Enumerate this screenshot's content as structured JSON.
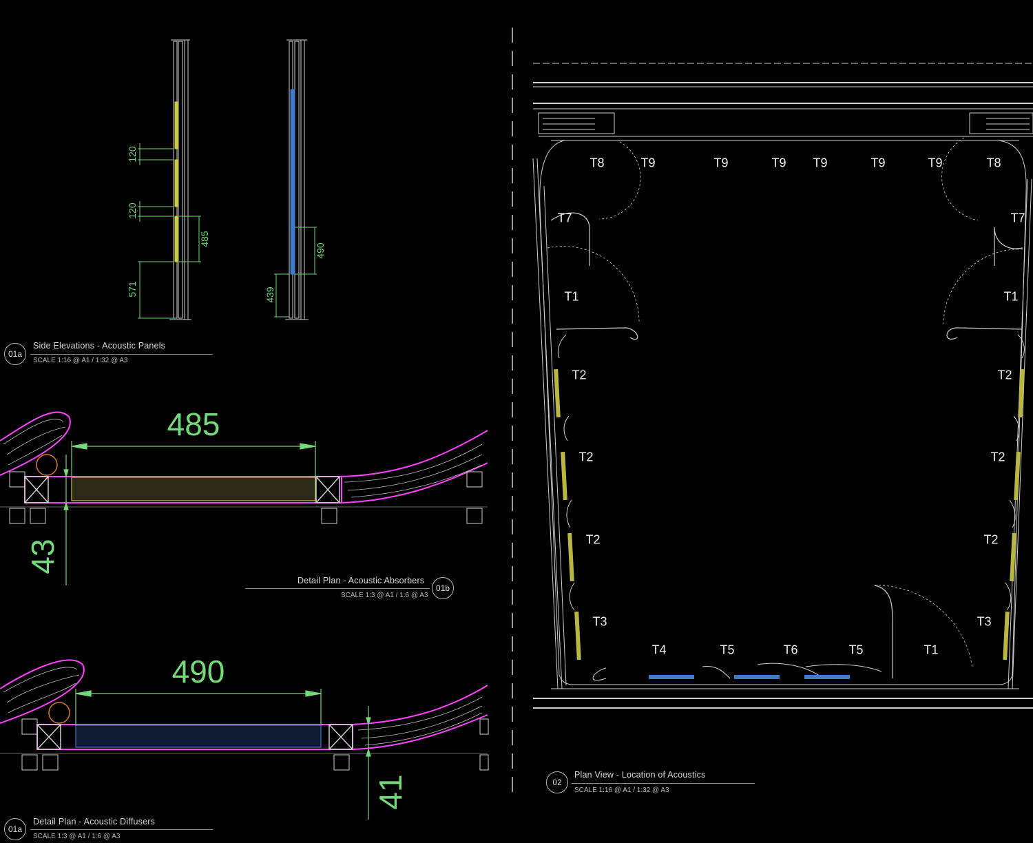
{
  "views": {
    "side_elevations": {
      "number": "01a",
      "title": "Side Elevations - Acoustic Panels",
      "scale": "SCALE 1:16 @ A1 / 1:32 @ A3"
    },
    "absorbers": {
      "number": "01b",
      "title": "Detail Plan - Acoustic Absorbers",
      "scale": "SCALE 1:3 @ A1 / 1:6 @ A3"
    },
    "diffusers": {
      "number": "01a",
      "title": "Detail Plan - Acoustic Diffusers",
      "scale": "SCALE 1:3 @ A1 / 1:6 @ A3"
    },
    "plan": {
      "number": "02",
      "title": "Plan View - Location of Acoustics",
      "scale": "SCALE 1:16 @ A1 / 1:32 @ A3"
    }
  },
  "dimensions": {
    "elev_left": [
      "120",
      "120",
      "485",
      "571"
    ],
    "elev_right": [
      "490",
      "439"
    ],
    "absorber_width": "485",
    "absorber_depth": "43",
    "diffuser_width": "490",
    "diffuser_depth": "41"
  },
  "plan_tags": [
    "T8",
    "T9",
    "T9",
    "T9",
    "T9",
    "T9",
    "T9",
    "T8",
    "T7",
    "T7",
    "T1",
    "T1",
    "T2",
    "T2",
    "T2",
    "T2",
    "T2",
    "T2",
    "T3",
    "T3",
    "T4",
    "T5",
    "T6",
    "T5",
    "T1"
  ],
  "colors": {
    "dimension": "#73d97a",
    "outline": "#ff40ff",
    "absorber": "#c8c84a",
    "diffuser": "#3f79c8",
    "linework": "#d0d0d0"
  }
}
